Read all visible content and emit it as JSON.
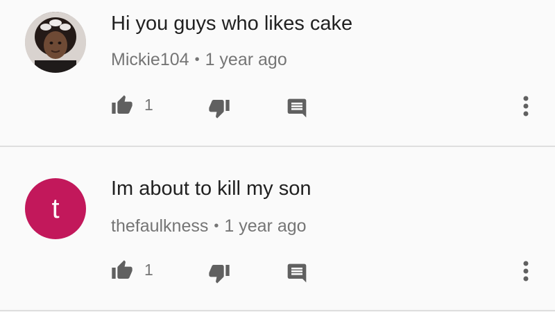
{
  "comments": [
    {
      "text": "Hi you guys who likes cake",
      "author": "Mickie104",
      "separator": "•",
      "time": "1 year ago",
      "likes": "1",
      "avatar_type": "photo"
    },
    {
      "text": "Im about to kill my son",
      "author": "thefaulkness",
      "separator": "•",
      "time": "1 year ago",
      "likes": "1",
      "avatar_type": "letter",
      "avatar_letter": "t",
      "avatar_color": "#c2185b"
    }
  ],
  "icons": {
    "like": "thumb-up-icon",
    "dislike": "thumb-down-icon",
    "reply": "reply-comment-icon",
    "more": "more-vertical-icon"
  },
  "colors": {
    "text_primary": "#212121",
    "text_secondary": "#757575",
    "icon": "#606060",
    "divider": "#dedede",
    "background": "#fafafa"
  }
}
